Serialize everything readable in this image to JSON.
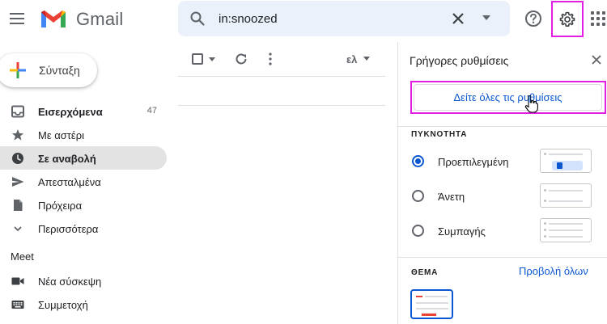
{
  "header": {
    "brand": "Gmail",
    "search_value": "in:snoozed"
  },
  "sidebar": {
    "compose_label": "Σύνταξη",
    "items": [
      {
        "label": "Εισερχόμενα",
        "count": "47",
        "icon": "inbox-icon"
      },
      {
        "label": "Με αστέρι",
        "count": "",
        "icon": "star-icon"
      },
      {
        "label": "Σε αναβολή",
        "count": "",
        "icon": "clock-icon"
      },
      {
        "label": "Απεσταλμένα",
        "count": "",
        "icon": "send-icon"
      },
      {
        "label": "Πρόχειρα",
        "count": "",
        "icon": "draft-icon"
      },
      {
        "label": "Περισσότερα",
        "count": "",
        "icon": "chevron-down-icon"
      }
    ],
    "active_index": 2,
    "meet_title": "Meet",
    "meet_items": [
      {
        "label": "Νέα σύσκεψη",
        "icon": "video-icon"
      },
      {
        "label": "Συμμετοχή",
        "icon": "keyboard-icon"
      }
    ]
  },
  "toolbar": {
    "lang_label": "ελ"
  },
  "quick_settings": {
    "title": "Γρήγορες ρυθμίσεις",
    "see_all_label": "Δείτε όλες τις ρυθμίσεις",
    "density_label": "ΠΥΚΝΟΤΗΤΑ",
    "density_options": [
      {
        "label": "Προεπιλεγμένη",
        "selected": true
      },
      {
        "label": "Άνετη",
        "selected": false
      },
      {
        "label": "Συμπαγής",
        "selected": false
      }
    ],
    "theme_label": "ΘΕΜΑ",
    "theme_view_all": "Προβολή όλων"
  },
  "colors": {
    "accent": "#0b57d0",
    "highlight_box": "#e31fe3",
    "active_nav": "#e3e3e3",
    "search_bg": "#eaf1fb"
  }
}
